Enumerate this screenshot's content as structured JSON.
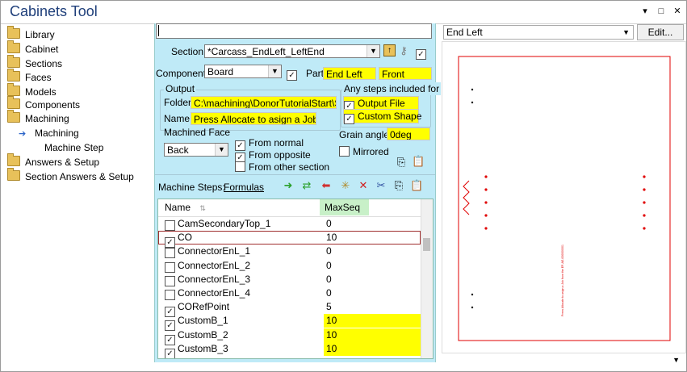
{
  "window": {
    "title": "Cabinets Tool",
    "pin_glyph": "▾",
    "restore_glyph": "□",
    "close_glyph": "✕"
  },
  "tree": {
    "items": [
      {
        "label": "Library",
        "type": "folder"
      },
      {
        "label": "Cabinet",
        "type": "folder"
      },
      {
        "label": "Sections",
        "type": "folder"
      },
      {
        "label": "Faces",
        "type": "folder"
      },
      {
        "label": "Models",
        "type": "folder"
      },
      {
        "label": "Components",
        "type": "folder"
      },
      {
        "label": "Machining",
        "type": "folder"
      },
      {
        "label": "Machining",
        "type": "arrow"
      },
      {
        "label": "Machine Step",
        "type": "plain"
      },
      {
        "label": "Answers & Setup",
        "type": "folder"
      },
      {
        "label": "Section Answers & Setup",
        "type": "folder"
      }
    ]
  },
  "form": {
    "section_label": "Section:",
    "section_value": "*Carcass_EndLeft_LeftEnd",
    "section_checked": true,
    "component_label": "Component:",
    "component_value": "Board",
    "component_checked": true,
    "part_label": "Part",
    "part_value_1": "End Left",
    "part_value_2": "Front",
    "output_label": "Output",
    "folder_label": "Folder:",
    "folder_value": "C:\\machining\\DonorTutorialStart\\S",
    "name_label": "Name:",
    "name_value": "Press Allocate to asign a Job",
    "steps_included_label": "Any steps included for",
    "output_file_label": "Output File",
    "output_file_checked": true,
    "custom_shape_label": "Custom Shape",
    "custom_shape_checked": true,
    "machined_face_label": "Machined Face",
    "machined_face_value": "Back",
    "from_normal_label": "From normal",
    "from_normal_checked": true,
    "from_opposite_label": "From opposite",
    "from_opposite_checked": true,
    "from_other_label": "From other section",
    "from_other_checked": false,
    "grain_label": "Grain angle:",
    "grain_value": "0deg",
    "mirrored_label": "Mirrored",
    "mirrored_checked": false
  },
  "steps": {
    "label": "Machine Steps:",
    "formulas_label": "Formulas",
    "col_name": "Name",
    "col_maxseq": "MaxSeq",
    "rows": [
      {
        "name": "CamSecondaryTop_1",
        "checked": false,
        "value": "0",
        "highlight": false,
        "selected": false
      },
      {
        "name": "CO",
        "checked": true,
        "value": "10",
        "highlight": false,
        "selected": true
      },
      {
        "name": "ConnectorEnL_1",
        "checked": false,
        "value": "0",
        "highlight": false,
        "selected": false
      },
      {
        "name": "ConnectorEnL_2",
        "checked": false,
        "value": "0",
        "highlight": false,
        "selected": false
      },
      {
        "name": "ConnectorEnL_3",
        "checked": false,
        "value": "0",
        "highlight": false,
        "selected": false
      },
      {
        "name": "ConnectorEnL_4",
        "checked": false,
        "value": "0",
        "highlight": false,
        "selected": false
      },
      {
        "name": "CORefPoint",
        "checked": true,
        "value": "5",
        "highlight": false,
        "selected": false
      },
      {
        "name": "CustomB_1",
        "checked": true,
        "value": "10",
        "highlight": true,
        "selected": false
      },
      {
        "name": "CustomB_2",
        "checked": true,
        "value": "10",
        "highlight": true,
        "selected": false
      },
      {
        "name": "CustomB_3",
        "checked": true,
        "value": "10",
        "highlight": true,
        "selected": false
      }
    ]
  },
  "preview": {
    "view_value": "End Left",
    "edit_label": "Edit...",
    "vertical_caption": "Press Allocate to asign a Job from the EP-AE-000000001"
  },
  "colors": {
    "panel_bg": "#bfeaf7",
    "highlight": "#ffff00",
    "title_text": "#1f3f7a",
    "preview_line": "#e00000"
  }
}
